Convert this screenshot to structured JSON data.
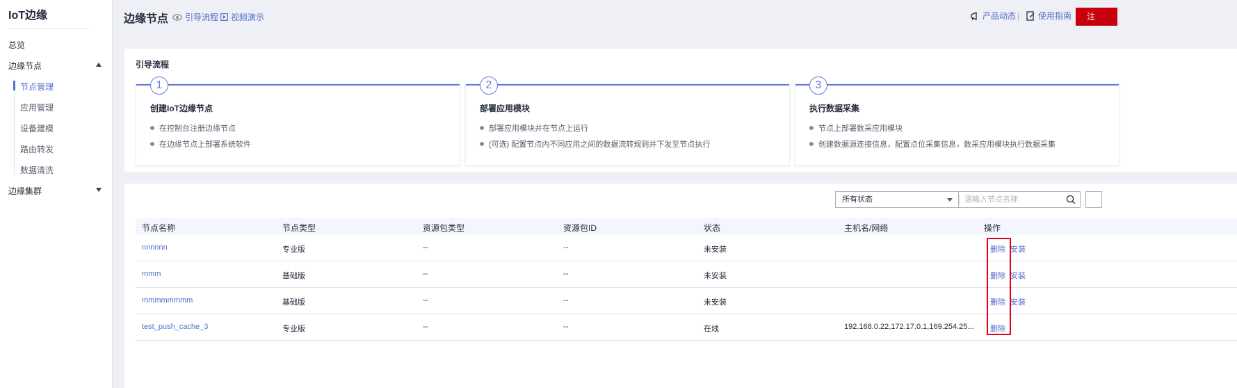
{
  "sidebar": {
    "brand": "IoT边缘",
    "items": [
      {
        "label": "总览"
      },
      {
        "label": "边缘节点"
      },
      {
        "label": "边缘集群"
      }
    ],
    "sub_items": [
      {
        "label": "节点管理"
      },
      {
        "label": "应用管理"
      },
      {
        "label": "设备建模"
      },
      {
        "label": "路由转发"
      },
      {
        "label": "数据清洗"
      }
    ]
  },
  "header": {
    "title": "边缘节点",
    "guide_link": "引导流程",
    "video_link": "视频演示",
    "product_news": "产品动态",
    "separator": "|",
    "user_guide": "使用指南",
    "primary_button": "注"
  },
  "guide": {
    "title": "引导流程",
    "steps": [
      {
        "number": "1",
        "heading": "创建IoT边缘节点",
        "bullets": [
          "在控制台注册边缘节点",
          "在边缘节点上部署系统软件"
        ]
      },
      {
        "number": "2",
        "heading": "部署应用模块",
        "bullets": [
          "部署应用模块并在节点上运行",
          "(可选) 配置节点内不同应用之间的数据流转规则并下发至节点执行"
        ]
      },
      {
        "number": "3",
        "heading": "执行数据采集",
        "bullets": [
          "节点上部署数采应用模块",
          "创建数据源连接信息，配置点位采集信息，数采应用模块执行数据采集"
        ]
      }
    ]
  },
  "filters": {
    "status_select": "所有状态",
    "search_placeholder": "请输入节点名称"
  },
  "table": {
    "columns": [
      "节点名称",
      "节点类型",
      "资源包类型",
      "资源包ID",
      "状态",
      "主机名/网络",
      "操作"
    ],
    "rows": [
      {
        "name": "nnnnnn",
        "type": "专业版",
        "pkg_type": "--",
        "pkg_id": "--",
        "status": "未安装",
        "host": "",
        "actions": [
          "删除",
          "安装"
        ]
      },
      {
        "name": "mmm",
        "type": "基础版",
        "pkg_type": "--",
        "pkg_id": "--",
        "status": "未安装",
        "host": "",
        "actions": [
          "删除",
          "安装"
        ]
      },
      {
        "name": "mmmmmmmm",
        "type": "基础版",
        "pkg_type": "--",
        "pkg_id": "--",
        "status": "未安装",
        "host": "",
        "actions": [
          "删除",
          "安装"
        ]
      },
      {
        "name": "test_push_cache_3",
        "type": "专业版",
        "pkg_type": "--",
        "pkg_id": "--",
        "status": "在线",
        "host": "192.168.0.22,172.17.0.1,169.254.25...",
        "actions": [
          "删除"
        ]
      }
    ]
  },
  "colors": {
    "accent": "#526ecc",
    "step_line": "#5e7ce0",
    "primary_button": "#c7000b",
    "highlight": "#e0001a"
  }
}
